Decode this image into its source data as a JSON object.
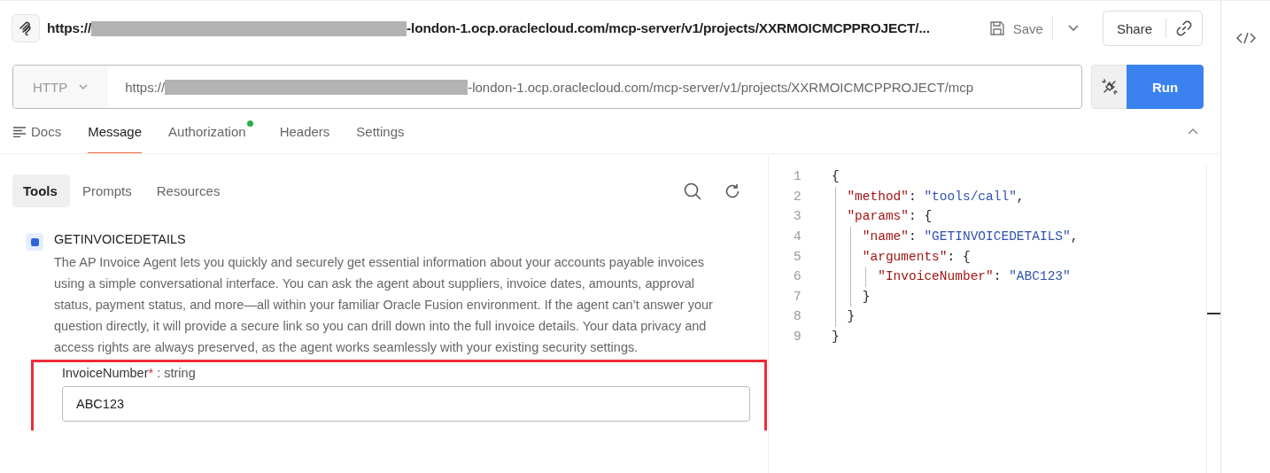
{
  "header": {
    "url_prefix": "https://",
    "url_suffix": "-london-1.ocp.oraclecloud.com/mcp-server/v1/projects/XXRMOICMCPPROJECT/...",
    "save_label": "Save",
    "share_label": "Share"
  },
  "request": {
    "method": "HTTP",
    "url_prefix": "https://",
    "url_suffix": "-london-1.ocp.oraclecloud.com/mcp-server/v1/projects/XXRMOICMCPPROJECT/mcp",
    "run_label": "Run"
  },
  "tabs": [
    {
      "label": "Docs",
      "selected": false,
      "kind": "docs"
    },
    {
      "label": "Message",
      "selected": true,
      "kind": "plain"
    },
    {
      "label": "Authorization",
      "selected": false,
      "kind": "dot",
      "color": "#22b04b"
    },
    {
      "label": "Headers",
      "selected": false,
      "kind": "plain"
    },
    {
      "label": "Settings",
      "selected": false,
      "kind": "plain"
    }
  ],
  "subtabs": [
    {
      "label": "Tools",
      "selected": true
    },
    {
      "label": "Prompts",
      "selected": false
    },
    {
      "label": "Resources",
      "selected": false
    }
  ],
  "tool": {
    "name": "GETINVOICEDETAILS",
    "selected": true,
    "description": "The AP Invoice Agent lets you quickly and securely get essential information about your accounts payable invoices using a simple conversational interface. You can ask the agent about suppliers, invoice dates, amounts, approval status, payment status, and more—all within your familiar Oracle Fusion environment. If the agent can’t answer your question directly, it will provide a secure link so you can drill down into the full invoice details. Your data privacy and access rights are always preserved, as the agent works seamlessly with your existing security settings.",
    "field": {
      "name": "InvoiceNumber",
      "required": "*",
      "type": " : string",
      "value": "ABC123"
    }
  },
  "editor": {
    "lines": [
      {
        "number": "1",
        "tokens": [
          {
            "kind": "punct",
            "text": "{"
          }
        ]
      },
      {
        "number": "2",
        "tokens": [
          {
            "kind": "key",
            "text": "  \"method\""
          },
          {
            "kind": "punct",
            "text": ": "
          },
          {
            "kind": "string",
            "text": "\"tools/call\""
          },
          {
            "kind": "punct",
            "text": ","
          }
        ]
      },
      {
        "number": "3",
        "tokens": [
          {
            "kind": "key",
            "text": "  \"params\""
          },
          {
            "kind": "punct",
            "text": ": {"
          }
        ]
      },
      {
        "number": "4",
        "tokens": [
          {
            "kind": "key",
            "text": "    \"name\""
          },
          {
            "kind": "punct",
            "text": ": "
          },
          {
            "kind": "string",
            "text": "\"GETINVOICEDETAILS\""
          },
          {
            "kind": "punct",
            "text": ","
          }
        ]
      },
      {
        "number": "5",
        "tokens": [
          {
            "kind": "key",
            "text": "    \"arguments\""
          },
          {
            "kind": "punct",
            "text": ": {"
          }
        ]
      },
      {
        "number": "6",
        "tokens": [
          {
            "kind": "key",
            "text": "      \"InvoiceNumber\""
          },
          {
            "kind": "punct",
            "text": ": "
          },
          {
            "kind": "string",
            "text": "\"ABC123\""
          }
        ]
      },
      {
        "number": "7",
        "tokens": [
          {
            "kind": "punct",
            "text": "    }"
          }
        ]
      },
      {
        "number": "8",
        "tokens": [
          {
            "kind": "punct",
            "text": "  }"
          }
        ]
      },
      {
        "number": "9",
        "tokens": [
          {
            "kind": "punct",
            "text": "}"
          }
        ]
      }
    ]
  }
}
